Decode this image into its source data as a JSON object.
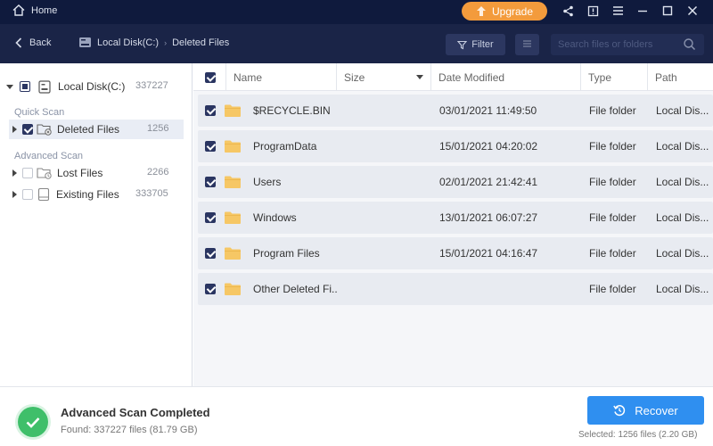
{
  "titlebar": {
    "home_label": "Home",
    "upgrade_label": "Upgrade",
    "controls": [
      "share-icon",
      "feedback-icon",
      "menu-icon",
      "minimize-icon",
      "maximize-icon",
      "close-icon"
    ]
  },
  "nav": {
    "back_label": "Back",
    "breadcrumb": [
      "Local Disk(C:)",
      "Deleted Files"
    ],
    "filter_label": "Filter",
    "search_placeholder": "Search files or folders"
  },
  "tree": {
    "root": {
      "label": "Local Disk(C:)",
      "count": "337227"
    },
    "quick_scan_label": "Quick Scan",
    "advanced_scan_label": "Advanced Scan",
    "items": [
      {
        "label": "Deleted Files",
        "count": "1256"
      },
      {
        "label": "Lost Files",
        "count": "2266"
      },
      {
        "label": "Existing Files",
        "count": "333705"
      }
    ]
  },
  "table": {
    "columns": [
      "Name",
      "Size",
      "Date Modified",
      "Type",
      "Path"
    ],
    "rows": [
      {
        "name": "$RECYCLE.BIN",
        "size": "",
        "date": "03/01/2021 11:49:50",
        "type": "File folder",
        "path": "Local Dis..."
      },
      {
        "name": "ProgramData",
        "size": "",
        "date": "15/01/2021 04:20:02",
        "type": "File folder",
        "path": "Local Dis..."
      },
      {
        "name": "Users",
        "size": "",
        "date": "02/01/2021 21:42:41",
        "type": "File folder",
        "path": "Local Dis..."
      },
      {
        "name": "Windows",
        "size": "",
        "date": "13/01/2021 06:07:27",
        "type": "File folder",
        "path": "Local Dis..."
      },
      {
        "name": "Program Files",
        "size": "",
        "date": "15/01/2021 04:16:47",
        "type": "File folder",
        "path": "Local Dis..."
      },
      {
        "name": "Other Deleted Fi...",
        "size": "",
        "date": "",
        "type": "File folder",
        "path": "Local Dis..."
      }
    ]
  },
  "status": {
    "title": "Advanced Scan Completed",
    "found": "Found: 337227 files (81.79 GB)",
    "recover_label": "Recover",
    "selected": "Selected: 1256 files (2.20 GB)"
  },
  "colors": {
    "titlebar": "#0f1a3d",
    "navbar": "#1a2447",
    "upgrade": "#f39b3c",
    "recover": "#2f8ff0",
    "success": "#3fbf6a",
    "folder": "#f6c765"
  }
}
